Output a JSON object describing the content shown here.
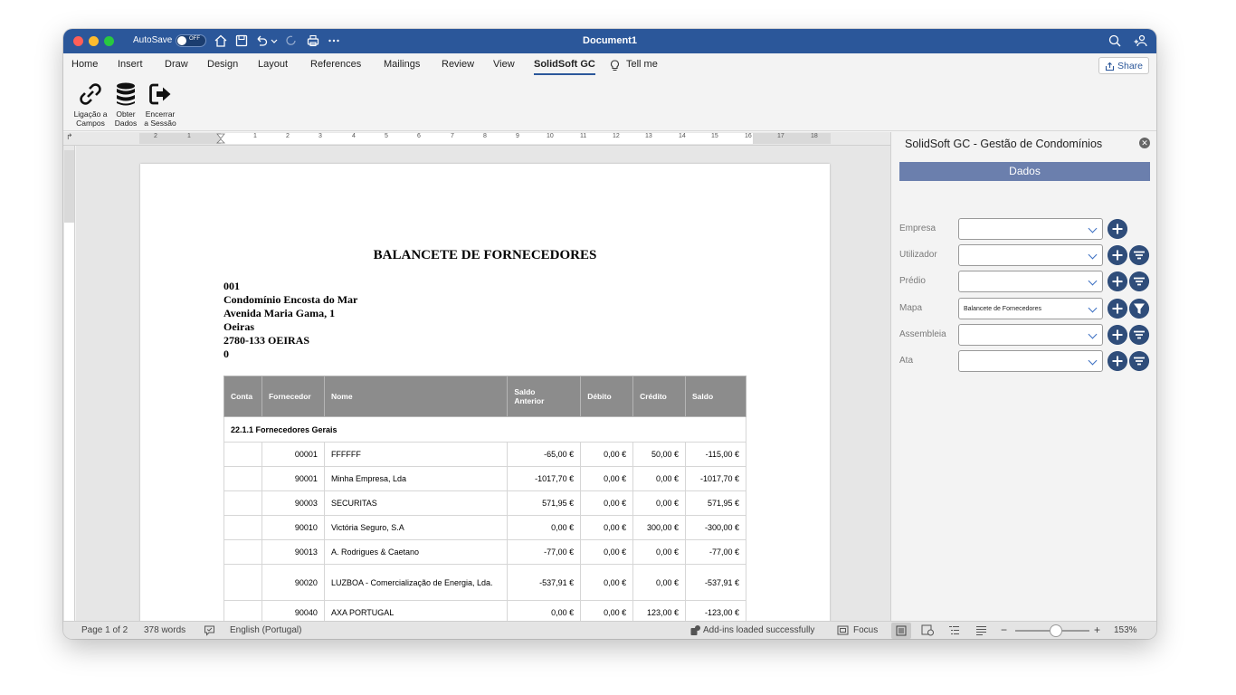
{
  "window": {
    "title": "Document1",
    "autosave_label": "AutoSave",
    "autosave_state": "OFF"
  },
  "tabs": [
    "Home",
    "Insert",
    "Draw",
    "Design",
    "Layout",
    "References",
    "Mailings",
    "Review",
    "View",
    "SolidSoft GC"
  ],
  "active_tab": "SolidSoft GC",
  "tell_me": "Tell me",
  "share_label": "Share",
  "ribbon": {
    "btn1_line1": "Ligação a",
    "btn1_line2": "Campos",
    "btn2_line1": "Obter",
    "btn2_line2": "Dados",
    "btn3_line1": "Encerrar",
    "btn3_line2": "a Sessão"
  },
  "ruler_numbers": [
    "2",
    "1",
    "1",
    "2",
    "3",
    "4",
    "5",
    "6",
    "7",
    "8",
    "9",
    "10",
    "11",
    "12",
    "13",
    "14",
    "15",
    "16",
    "17",
    "18"
  ],
  "report": {
    "title": "BALANCETE DE FORNECEDORES",
    "address": [
      "001",
      "Condomínio Encosta do Mar",
      "Avenida Maria Gama, 1",
      "Oeiras",
      "2780-133 OEIRAS",
      "0"
    ],
    "headers": {
      "conta": "Conta",
      "fornecedor": "Fornecedor",
      "nome": "Nome",
      "saldo_anterior_1": "Saldo",
      "saldo_anterior_2": "Anterior",
      "debito": "Débito",
      "credito": "Crédito",
      "saldo": "Saldo"
    },
    "group": "22.1.1 Fornecedores Gerais",
    "rows": [
      {
        "fornecedor": "00001",
        "nome": "FFFFFF",
        "saldo_anterior": "-65,00 €",
        "debito": "0,00 €",
        "credito": "50,00 €",
        "saldo": "-115,00 €"
      },
      {
        "fornecedor": "90001",
        "nome": "Minha Empresa, Lda",
        "saldo_anterior": "-1017,70 €",
        "debito": "0,00 €",
        "credito": "0,00 €",
        "saldo": "-1017,70 €"
      },
      {
        "fornecedor": "90003",
        "nome": "SECURITAS",
        "saldo_anterior": "571,95 €",
        "debito": "0,00 €",
        "credito": "0,00 €",
        "saldo": "571,95 €"
      },
      {
        "fornecedor": "90010",
        "nome": "Victória Seguro, S.A",
        "saldo_anterior": "0,00 €",
        "debito": "0,00 €",
        "credito": "300,00 €",
        "saldo": "-300,00 €"
      },
      {
        "fornecedor": "90013",
        "nome": "A. Rodrigues & Caetano",
        "saldo_anterior": "-77,00 €",
        "debito": "0,00 €",
        "credito": "0,00 €",
        "saldo": "-77,00 €"
      },
      {
        "fornecedor": "90020",
        "nome": "LUZBOA - Comercialização de Energia, Lda.",
        "saldo_anterior": "-537,91 €",
        "debito": "0,00 €",
        "credito": "0,00 €",
        "saldo": "-537,91 €"
      },
      {
        "fornecedor": "90040",
        "nome": "AXA PORTUGAL",
        "saldo_anterior": "0,00 €",
        "debito": "0,00 €",
        "credito": "123,00 €",
        "saldo": "-123,00 €"
      }
    ]
  },
  "pane": {
    "title": "SolidSoft GC - Gestão de Condomínios",
    "header": "Dados",
    "fields": [
      {
        "label": "Empresa",
        "value": ""
      },
      {
        "label": "Utilizador",
        "value": ""
      },
      {
        "label": "Prédio",
        "value": ""
      },
      {
        "label": "Mapa",
        "value": "Balancete de Fornecedores"
      },
      {
        "label": "Assembleia",
        "value": ""
      },
      {
        "label": "Ata",
        "value": ""
      }
    ]
  },
  "status": {
    "page": "Page 1 of 2",
    "words": "378 words",
    "language": "English (Portugal)",
    "addins": "Add-ins loaded successfully",
    "focus": "Focus",
    "zoom": "153%"
  },
  "colors": {
    "titlebar": "#2b579a",
    "pane_header": "#6b7fad",
    "circle_buttons": "#2f4d7a",
    "table_header": "#8c8c8c"
  }
}
